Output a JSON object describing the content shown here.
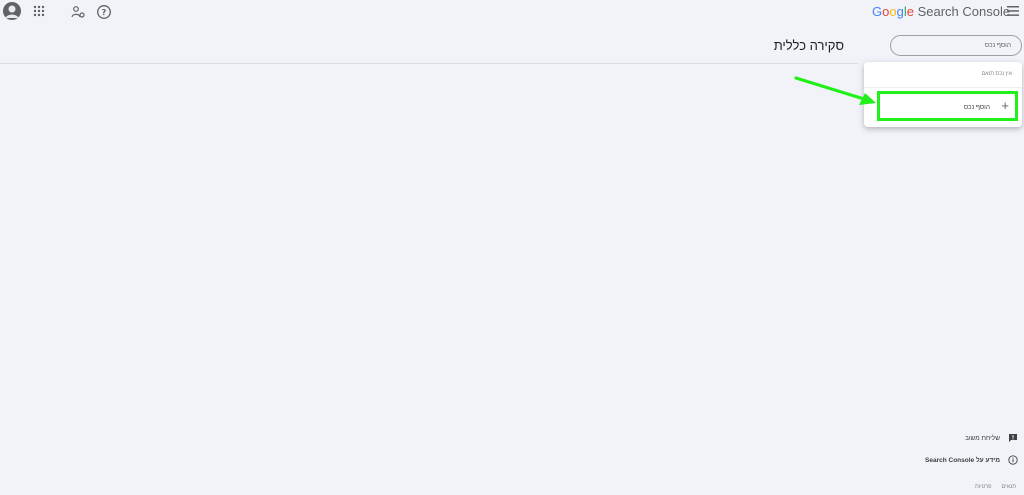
{
  "header": {
    "logo_google": [
      "G",
      "o",
      "o",
      "g",
      "l",
      "e"
    ],
    "logo_product": "Search Console"
  },
  "page": {
    "title": "סקירה כללית"
  },
  "property_search": {
    "placeholder": "הוסף נכס",
    "no_match": "אין נכס תואם",
    "add_label": "הוסף נכס"
  },
  "footer": {
    "feedback": "שליחת משוב",
    "about": "מידע על Search Console",
    "legal": [
      "תנאים",
      "פרטיות"
    ]
  },
  "colors": {
    "highlight": "#22f01a",
    "background": "#f1f3f9"
  },
  "icons": [
    "avatar-icon",
    "apps-icon",
    "share-icon",
    "help-icon",
    "hamburger-menu-icon",
    "plus-icon",
    "feedback-icon",
    "info-icon",
    "arrow-annotation"
  ]
}
